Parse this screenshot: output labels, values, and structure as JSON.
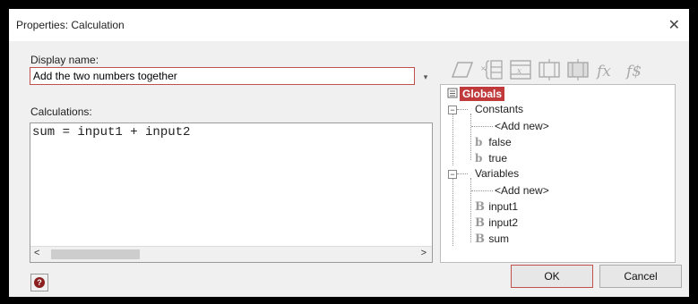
{
  "window": {
    "title": "Properties: Calculation",
    "close_glyph": "✕"
  },
  "display_name": {
    "label": "Display name:",
    "value": "Add the two numbers together",
    "dropdown_glyph": "▾"
  },
  "calculations": {
    "label": "Calculations:",
    "code": "sum = input1 + input2",
    "scroll_left": "<",
    "scroll_right": ">"
  },
  "toolbar": {
    "icons": [
      "parallelogram-icon",
      "variable-bracket-icon",
      "x-box-icon",
      "process-icon",
      "subroutine-icon",
      "fx-icon",
      "fs-icon"
    ],
    "fx_text": "fx",
    "fs_text": "f$"
  },
  "tree": {
    "root": "Globals",
    "constants": {
      "label": "Constants",
      "add_new": "<Add new>",
      "items": [
        "false",
        "true"
      ]
    },
    "variables": {
      "label": "Variables",
      "add_new": "<Add new>",
      "items": [
        "input1",
        "input2",
        "sum"
      ]
    },
    "minus": "−",
    "b_small": "b",
    "b_big": "B"
  },
  "buttons": {
    "help": "?",
    "ok": "OK",
    "cancel": "Cancel"
  },
  "colors": {
    "accent": "#c0504d",
    "globals_bg": "#c0393b",
    "icon_gray": "#999999"
  }
}
